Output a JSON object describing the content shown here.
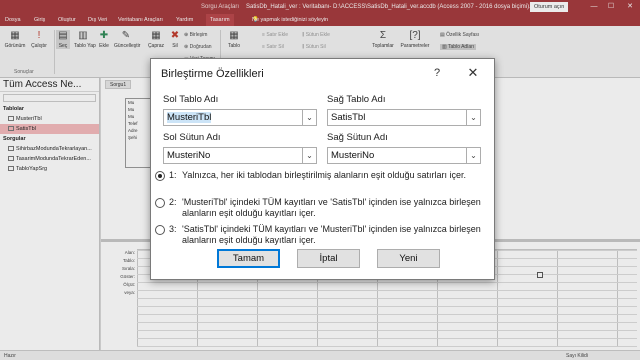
{
  "titlebar": {
    "context_label": "Sorgu Araçları",
    "title": "SatisDb_Hatali_ver : Veritabanı- D:\\ACCESS\\SatisDb_Hatali_ver.accdb (Access 2007 - 2016 dosya biçimi)...",
    "signin": "Oturum açın",
    "min": "—",
    "max": "☐",
    "close": "✕"
  },
  "tabs": [
    "Dosya",
    "Giriş",
    "Oluştur",
    "Dış Veri",
    "Veritabanı Araçları",
    "Yardım",
    "Tasarım",
    "Ne yapmak istediğinizi söyleyin"
  ],
  "ribbon": {
    "gorunum": "Görünüm",
    "calistir": "Çalıştır",
    "sonuclar": "Sonuçlar",
    "sec": "Seç",
    "tablo_yap": "Tablo Yap",
    "ekle": "Ekle",
    "guncelle": "Güncelleştir",
    "capraz": "Çapraz",
    "sil": "Sil",
    "birlesim": "Birleşim",
    "dogrudan": "Doğrudan",
    "veri_tanimi": "Veri Tanımı",
    "tablo": "Tablo",
    "satir_ekle": "Satır Ekle",
    "satir_sil": "Satır Sil",
    "sutun_ekle": "Sütun Ekle",
    "sutun_sil": "Sütun Sil",
    "toplamlar": "Toplamlar",
    "parametreler": "Parametreler",
    "ozellik_sayfasi": "Özellik Sayfası",
    "tablo_adlari": "Tablo Adları"
  },
  "nav": {
    "header": "Tüm Access Ne...",
    "sections": [
      {
        "title": "Tablolar",
        "items": [
          "MusteriTbl",
          "SatisTbl"
        ]
      },
      {
        "title": "Sorgular",
        "items": [
          "SihirbazModundaTekrarlayan...",
          "TasarimModundaTekrarEden...",
          "TabloYapSrg"
        ]
      }
    ]
  },
  "work": {
    "doc_tab": "Sorgu1",
    "field_list": [
      "Mu",
      "Mu",
      "Mu",
      "Telef",
      "Adre",
      "Şehi"
    ],
    "qbe_labels": [
      "Alan:",
      "Tablo:",
      "Sırala:",
      "Göster:",
      "Ölçüt:",
      "veya:"
    ]
  },
  "status": {
    "left": "Hazır",
    "right": "Sayı Kilidi"
  },
  "dialog": {
    "title": "Birleştirme Özellikleri",
    "help": "?",
    "close": "✕",
    "left_table_label": "Sol Tablo Adı",
    "right_table_label": "Sağ Tablo Adı",
    "left_table_value": "MusteriTbl",
    "right_table_value": "SatisTbl",
    "left_column_label": "Sol Sütun Adı",
    "right_column_label": "Sağ Sütun Adı",
    "left_column_value": "MusteriNo",
    "right_column_value": "MusteriNo",
    "options": [
      {
        "num": "1:",
        "text": "Yalnızca, her iki tablodan birleştirilmiş alanların eşit olduğu satırları içer.",
        "selected": true
      },
      {
        "num": "2:",
        "text": "'MusteriTbl' içindeki TÜM kayıtları ve 'SatisTbl' içinden ise yalnızca birleşen alanların eşit olduğu kayıtları içer.",
        "selected": false
      },
      {
        "num": "3:",
        "text": "'SatisTbl' içindeki TÜM kayıtları ve 'MusteriTbl' içinden ise yalnızca birleşen alanların eşit olduğu kayıtları içer.",
        "selected": false
      }
    ],
    "ok": "Tamam",
    "cancel": "İptal",
    "new": "Yeni"
  }
}
